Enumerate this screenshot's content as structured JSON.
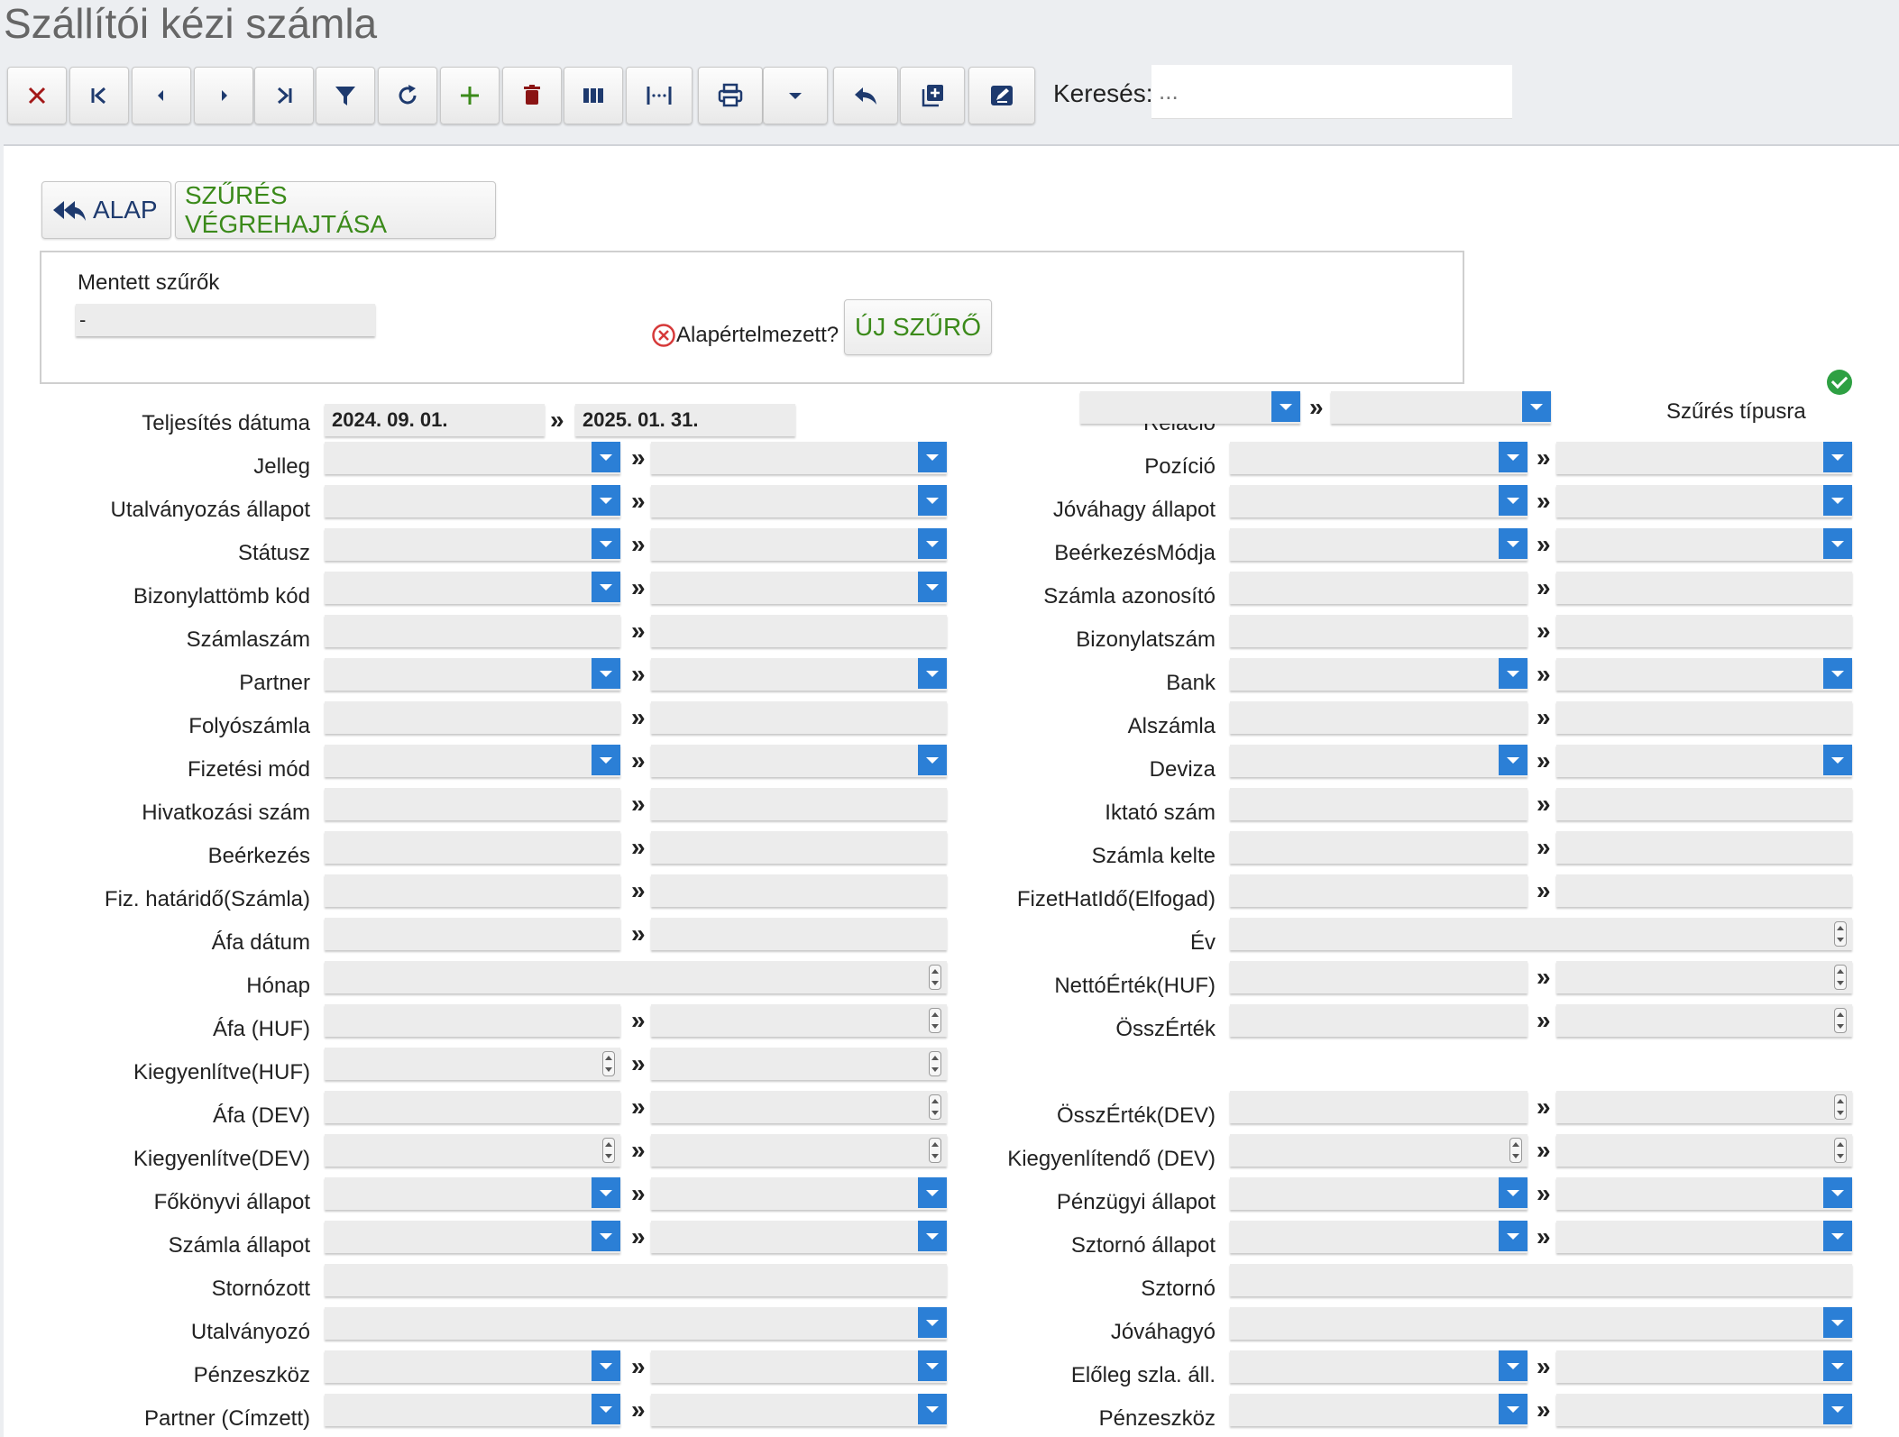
{
  "page": {
    "title": "Szállítói kézi számla"
  },
  "toolbar": {
    "buttons": [
      {
        "name": "close-button",
        "icon": "close-icon"
      },
      {
        "name": "first-record-button",
        "icon": "first-icon"
      },
      {
        "name": "previous-record-button",
        "icon": "prev-icon"
      },
      {
        "name": "next-record-button",
        "icon": "next-icon"
      },
      {
        "name": "last-record-button",
        "icon": "last-icon"
      },
      {
        "name": "filter-button",
        "icon": "filter-icon"
      },
      {
        "name": "refresh-button",
        "icon": "refresh-icon"
      },
      {
        "name": "add-button",
        "icon": "plus-icon"
      },
      {
        "name": "delete-button",
        "icon": "trash-icon"
      },
      {
        "name": "columns-button",
        "icon": "columns-icon"
      },
      {
        "name": "column-width-button",
        "icon": "column-width-icon"
      },
      {
        "name": "print-button",
        "icon": "print-icon"
      },
      {
        "name": "print-menu-button",
        "icon": "caret-down-icon"
      },
      {
        "name": "undo-button",
        "icon": "undo-icon"
      },
      {
        "name": "duplicate-button",
        "icon": "copy-plus-icon"
      },
      {
        "name": "edit-button",
        "icon": "edit-icon"
      }
    ],
    "search_label": "Keresés:",
    "search_placeholder": "..."
  },
  "tabs": {
    "alap": "ALAP",
    "execute": "SZŰRÉS VÉGREHAJTÁSA"
  },
  "saved_filters": {
    "label": "Mentett szűrők",
    "value": "-",
    "default_label": "Alapértelmezett?",
    "new_button": "ÚJ SZŰRŐ"
  },
  "filter_by_type_label": "Szűrés típusra",
  "colors": {
    "dropdown": "#2b7fd6",
    "green": "#3b8a1a",
    "red": "#c0392b",
    "navy": "#1e3a6e"
  },
  "left_fields": [
    {
      "label": "Teljesítés dátuma",
      "type": "date",
      "from": "2024. 09. 01.",
      "to": "2025. 01. 31."
    },
    {
      "label": "Jelleg",
      "type": "select-range"
    },
    {
      "label": "Utalványozás állapot",
      "type": "select-range"
    },
    {
      "label": "Státusz",
      "type": "select-range"
    },
    {
      "label": "Bizonylattömb kód",
      "type": "select-range"
    },
    {
      "label": "Számlaszám",
      "type": "text-range"
    },
    {
      "label": "Partner",
      "type": "select-range"
    },
    {
      "label": "Folyószámla",
      "type": "text-range"
    },
    {
      "label": "Fizetési mód",
      "type": "select-range"
    },
    {
      "label": "Hivatkozási szám",
      "type": "text-range"
    },
    {
      "label": "Beérkezés",
      "type": "text-range"
    },
    {
      "label": "Fiz. határidő(Számla)",
      "type": "text-range"
    },
    {
      "label": "Áfa dátum",
      "type": "text-range"
    },
    {
      "label": "Hónap",
      "type": "number-single"
    },
    {
      "label": "Áfa (HUF)",
      "type": "number-range-right"
    },
    {
      "label": "Kiegyenlítve(HUF)",
      "type": "number-range"
    },
    {
      "label": "Áfa (DEV)",
      "type": "number-range-right"
    },
    {
      "label": "Kiegyenlítve(DEV)",
      "type": "number-range"
    },
    {
      "label": "Főkönyvi állapot",
      "type": "select-range"
    },
    {
      "label": "Számla állapot",
      "type": "select-range"
    },
    {
      "label": "Stornózott",
      "type": "text-single"
    },
    {
      "label": "Utalványozó",
      "type": "select-single"
    },
    {
      "label": "Pénzeszköz",
      "type": "select-range"
    },
    {
      "label": "Partner (Címzett)",
      "type": "select-range"
    }
  ],
  "right_fields": [
    {
      "label": "Reláció",
      "type": "select-range-top"
    },
    {
      "label": "Pozíció",
      "type": "select-range"
    },
    {
      "label": "Jóváhagy állapot",
      "type": "select-range"
    },
    {
      "label": "BeérkezésMódja",
      "type": "select-range"
    },
    {
      "label": "Számla azonosító",
      "type": "text-range"
    },
    {
      "label": "Bizonylatszám",
      "type": "text-range"
    },
    {
      "label": "Bank",
      "type": "select-range"
    },
    {
      "label": "Alszámla",
      "type": "text-range"
    },
    {
      "label": "Deviza",
      "type": "select-range"
    },
    {
      "label": "Iktató szám",
      "type": "text-range"
    },
    {
      "label": "Számla kelte",
      "type": "text-range"
    },
    {
      "label": "FizetHatIdő(Elfogad)",
      "type": "text-range"
    },
    {
      "label": "Év",
      "type": "number-single"
    },
    {
      "label": "NettóÉrték(HUF)",
      "type": "number-range-right"
    },
    {
      "label": "ÖsszÉrték",
      "type": "number-range-right"
    },
    {
      "label": "",
      "type": "none"
    },
    {
      "label": "ÖsszÉrték(DEV)",
      "type": "number-range-right"
    },
    {
      "label": "Kiegyenlítendő (DEV)",
      "type": "number-range"
    },
    {
      "label": "Pénzügyi állapot",
      "type": "select-range"
    },
    {
      "label": "Sztornó állapot",
      "type": "select-range"
    },
    {
      "label": "Sztornó",
      "type": "text-single"
    },
    {
      "label": "Jóváhagyó",
      "type": "select-single"
    },
    {
      "label": "Előleg szla. áll.",
      "type": "select-range"
    },
    {
      "label": "Pénzeszköz",
      "type": "select-range"
    }
  ]
}
